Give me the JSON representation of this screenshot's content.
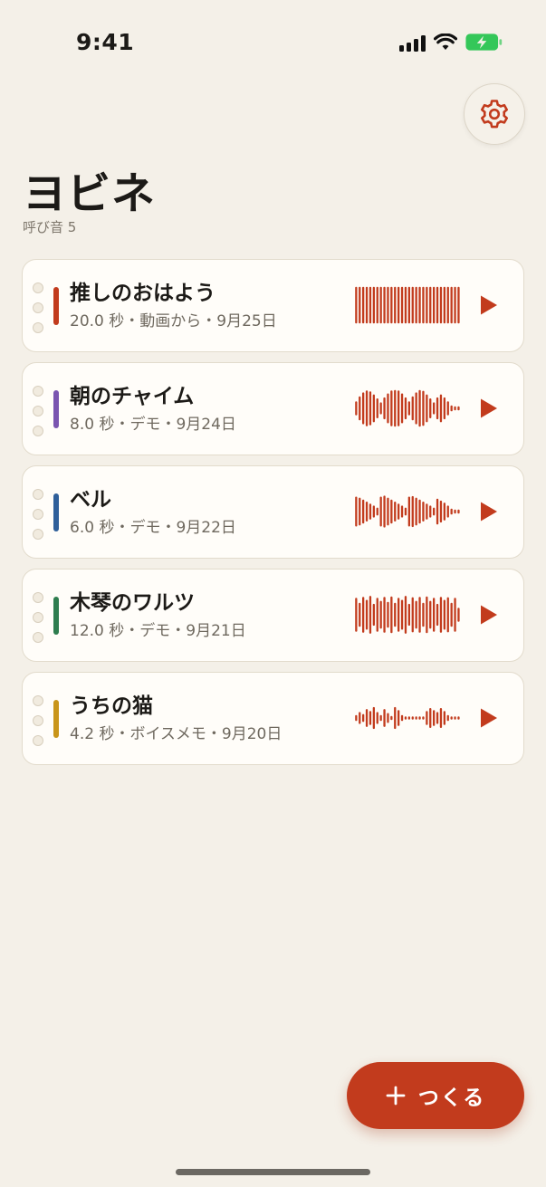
{
  "status_bar": {
    "time": "9:41",
    "icons": [
      "cellular-signal-icon",
      "wifi-icon",
      "battery-charging-icon"
    ],
    "battery_color": "#34c759"
  },
  "header": {
    "title": "ヨビネ",
    "count_label": "呼び音 5",
    "settings_icon": "gear-icon"
  },
  "colors": {
    "background": "#f4f0e8",
    "accent": "#c23b1d",
    "card_border": "#e2dbcc"
  },
  "sounds": [
    {
      "name": "推しのおはよう",
      "meta": "20.0 秒・動画から・9月25日",
      "color": "#c23b1d",
      "wave": [
        0.92,
        0.92,
        0.92,
        0.92,
        0.92,
        0.92,
        0.92,
        0.92,
        0.92,
        0.92,
        0.92,
        0.92,
        0.92,
        0.92,
        0.92,
        0.92,
        0.92,
        0.92,
        0.92,
        0.92,
        0.92,
        0.92,
        0.92,
        0.92,
        0.92,
        0.92,
        0.92,
        0.92,
        0.92,
        0.92
      ]
    },
    {
      "name": "朝のチャイム",
      "meta": "8.0 秒・デモ・9月24日",
      "color": "#7a55b0",
      "wave": [
        0.35,
        0.6,
        0.8,
        0.9,
        0.85,
        0.7,
        0.5,
        0.3,
        0.55,
        0.75,
        0.9,
        0.92,
        0.9,
        0.75,
        0.55,
        0.35,
        0.6,
        0.8,
        0.92,
        0.88,
        0.7,
        0.5,
        0.3,
        0.55,
        0.7,
        0.55,
        0.35,
        0.15,
        0.1,
        0.1
      ]
    },
    {
      "name": "ベル",
      "meta": "6.0 秒・デモ・9月22日",
      "color": "#2f5f9a",
      "wave": [
        0.75,
        0.7,
        0.6,
        0.5,
        0.4,
        0.3,
        0.2,
        0.75,
        0.8,
        0.7,
        0.6,
        0.5,
        0.4,
        0.3,
        0.2,
        0.75,
        0.78,
        0.7,
        0.6,
        0.5,
        0.4,
        0.3,
        0.2,
        0.65,
        0.55,
        0.45,
        0.3,
        0.15,
        0.1,
        0.1
      ]
    },
    {
      "name": "木琴のワルツ",
      "meta": "12.0 秒・デモ・9月21日",
      "color": "#2e7d4f",
      "wave": [
        0.85,
        0.6,
        0.9,
        0.75,
        0.95,
        0.55,
        0.85,
        0.7,
        0.9,
        0.65,
        0.92,
        0.6,
        0.85,
        0.75,
        0.95,
        0.55,
        0.88,
        0.7,
        0.9,
        0.6,
        0.92,
        0.7,
        0.85,
        0.55,
        0.9,
        0.75,
        0.88,
        0.6,
        0.85,
        0.35
      ]
    },
    {
      "name": "うちの猫",
      "meta": "4.2 秒・ボイスメモ・9月20日",
      "color": "#c9951a",
      "wave": [
        0.15,
        0.3,
        0.2,
        0.45,
        0.35,
        0.55,
        0.3,
        0.15,
        0.45,
        0.25,
        0.1,
        0.55,
        0.4,
        0.15,
        0.08,
        0.08,
        0.08,
        0.08,
        0.08,
        0.08,
        0.35,
        0.5,
        0.4,
        0.3,
        0.5,
        0.35,
        0.15,
        0.08,
        0.08,
        0.08
      ]
    }
  ],
  "create_button": {
    "label": "つくる",
    "icon": "plus-icon"
  }
}
